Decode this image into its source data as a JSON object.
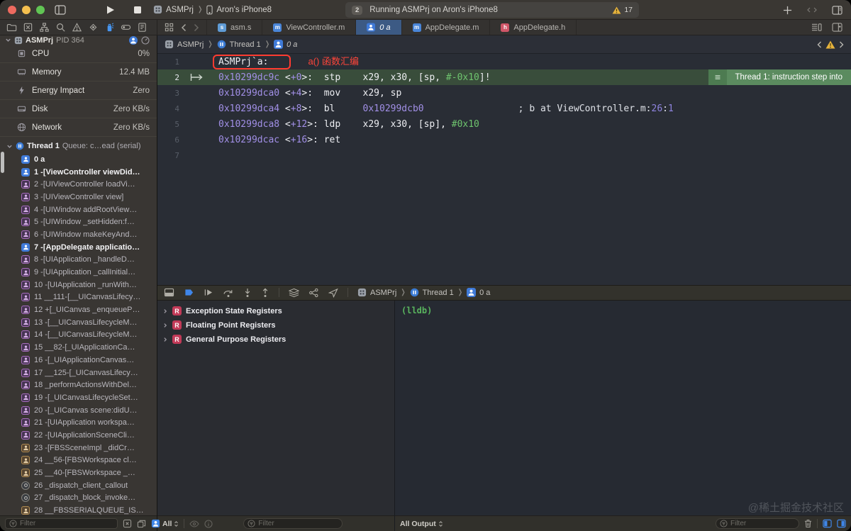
{
  "colors": {
    "accent_blue": "#3f86e8",
    "banner_green": "#5b8b5f",
    "highlight_green": "#394d3b",
    "annotation_red": "#ff3b30",
    "address_purple": "#a18fe6",
    "immediate_green": "#6ec46e",
    "warning_yellow": "#e6b33c",
    "register_badge": "#c23a58"
  },
  "titlebar": {
    "scheme": {
      "project": "ASMPrj",
      "device": "Aron's iPhone8"
    },
    "status": {
      "badge": "2",
      "text": "Running ASMPrj on Aron's iPhone8",
      "warning_count": "17"
    }
  },
  "tabbar": {
    "tabs": [
      {
        "label": "asm.s",
        "icon": "file-s-icon",
        "glyph": "s",
        "color": "#5f9bd5",
        "active": false
      },
      {
        "label": "ViewController.m",
        "icon": "file-m-icon",
        "glyph": "m",
        "color": "#4a86d8",
        "active": false
      },
      {
        "label": "0 a",
        "icon": "person-icon",
        "glyph": "person",
        "color": "#3f7ad8",
        "active": true
      },
      {
        "label": "AppDelegate.m",
        "icon": "file-m-icon",
        "glyph": "m",
        "color": "#4a86d8",
        "active": false
      },
      {
        "label": "AppDelegate.h",
        "icon": "file-h-icon",
        "glyph": "h",
        "color": "#d05668",
        "active": false
      }
    ]
  },
  "sidebar": {
    "process": {
      "name": "ASMPrj",
      "pid": "PID 364"
    },
    "gauges": [
      {
        "label": "CPU",
        "value": "0%",
        "icon": "cpu-icon"
      },
      {
        "label": "Memory",
        "value": "12.4 MB",
        "icon": "memory-icon"
      },
      {
        "label": "Energy Impact",
        "value": "Zero",
        "icon": "energy-icon"
      },
      {
        "label": "Disk",
        "value": "Zero KB/s",
        "icon": "disk-icon"
      },
      {
        "label": "Network",
        "value": "Zero KB/s",
        "icon": "network-icon"
      }
    ],
    "thread": {
      "label": "Thread 1",
      "queue": "Queue: c…ead (serial)"
    },
    "frames": [
      {
        "label": "0 a",
        "type": "user"
      },
      {
        "label": "1 -[ViewController viewDid…",
        "type": "user"
      },
      {
        "label": "2 -[UIViewController loadVi…",
        "type": "fw"
      },
      {
        "label": "3 -[UIViewController view]",
        "type": "fw"
      },
      {
        "label": "4 -[UIWindow addRootView…",
        "type": "fw"
      },
      {
        "label": "5 -[UIWindow _setHidden:f…",
        "type": "fw"
      },
      {
        "label": "6 -[UIWindow makeKeyAnd…",
        "type": "fw"
      },
      {
        "label": "7 -[AppDelegate applicatio…",
        "type": "user"
      },
      {
        "label": "8 -[UIApplication _handleD…",
        "type": "fw"
      },
      {
        "label": "9 -[UIApplication _callInitial…",
        "type": "fw"
      },
      {
        "label": "10 -[UIApplication _runWith…",
        "type": "fw"
      },
      {
        "label": "11 __111-[__UICanvasLifecy…",
        "type": "fw"
      },
      {
        "label": "12 +[_UICanvas _enqueueP…",
        "type": "fw"
      },
      {
        "label": "13 -[__UICanvasLifecycleM…",
        "type": "fw"
      },
      {
        "label": "14 -[__UICanvasLifecycleM…",
        "type": "fw"
      },
      {
        "label": "15 __82-[_UIApplicationCa…",
        "type": "fw"
      },
      {
        "label": "16 -[_UIApplicationCanvas…",
        "type": "fw"
      },
      {
        "label": "17 __125-[_UICanvasLifecy…",
        "type": "fw"
      },
      {
        "label": "18 _performActionsWithDel…",
        "type": "fw"
      },
      {
        "label": "19 -[_UICanvasLifecycleSet…",
        "type": "fw"
      },
      {
        "label": "20 -[_UICanvas scene:didU…",
        "type": "fw"
      },
      {
        "label": "21 -[UIApplication workspa…",
        "type": "fw"
      },
      {
        "label": "22 -[UIApplicationSceneCli…",
        "type": "fw"
      },
      {
        "label": "23 -[FBSSceneImpl _didCr…",
        "type": "lib"
      },
      {
        "label": "24 __56-[FBSWorkspace cl…",
        "type": "lib"
      },
      {
        "label": "25 __40-[FBSWorkspace _…",
        "type": "lib"
      },
      {
        "label": "26 _dispatch_client_callout",
        "type": "sys"
      },
      {
        "label": "27 _dispatch_block_invoke…",
        "type": "sys"
      },
      {
        "label": "28 __FBSSERIALQUEUE_IS…",
        "type": "lib"
      }
    ],
    "filter_placeholder": "Filter"
  },
  "editor": {
    "jumpbar": [
      {
        "icon": "app-icon",
        "label": "ASMPrj"
      },
      {
        "icon": "thread-icon",
        "label": "Thread 1"
      },
      {
        "icon": "person-icon",
        "label": "0 a",
        "italic": true
      }
    ],
    "lines": [
      {
        "num": "1",
        "boxed": "ASMPrj`a:",
        "annotation": "a() 函数汇编",
        "tokens": []
      },
      {
        "num": "2",
        "current": true,
        "banner": "Thread 1: instruction step into",
        "tokens": [
          [
            "0x10299dc9c",
            "a"
          ],
          [
            " <",
            "p"
          ],
          [
            "+0",
            "a"
          ],
          [
            ">:  ",
            "p"
          ],
          [
            "stp    ",
            "p"
          ],
          [
            "x29, x30, [sp, ",
            "p"
          ],
          [
            "#-0x10",
            "g"
          ],
          [
            "]!",
            "p"
          ]
        ]
      },
      {
        "num": "3",
        "tokens": [
          [
            "0x10299dca0",
            "a"
          ],
          [
            " <",
            "p"
          ],
          [
            "+4",
            "a"
          ],
          [
            ">:  ",
            "p"
          ],
          [
            "mov    ",
            "p"
          ],
          [
            "x29, sp",
            "p"
          ]
        ]
      },
      {
        "num": "4",
        "tokens": [
          [
            "0x10299dca4",
            "a"
          ],
          [
            " <",
            "p"
          ],
          [
            "+8",
            "a"
          ],
          [
            ">:  ",
            "p"
          ],
          [
            "bl     ",
            "p"
          ],
          [
            "0x10299dcb0",
            "a"
          ],
          [
            "                 ",
            "p"
          ],
          [
            "; b at ViewController.m:",
            "c"
          ],
          [
            "26",
            "n"
          ],
          [
            ":",
            "c"
          ],
          [
            "1",
            "n"
          ]
        ]
      },
      {
        "num": "5",
        "tokens": [
          [
            "0x10299dca8",
            "a"
          ],
          [
            " <",
            "p"
          ],
          [
            "+12",
            "a"
          ],
          [
            ">: ",
            "p"
          ],
          [
            "ldp    ",
            "p"
          ],
          [
            "x29, x30, [sp], ",
            "p"
          ],
          [
            "#0x10",
            "g"
          ]
        ]
      },
      {
        "num": "6",
        "tokens": [
          [
            "0x10299dcac",
            "a"
          ],
          [
            " <",
            "p"
          ],
          [
            "+16",
            "a"
          ],
          [
            ">: ",
            "p"
          ],
          [
            "ret",
            "p"
          ]
        ]
      },
      {
        "num": "7",
        "tokens": []
      }
    ]
  },
  "debug": {
    "breadcrumb": [
      {
        "icon": "app-icon",
        "label": "ASMPrj"
      },
      {
        "icon": "thread-icon",
        "label": "Thread 1"
      },
      {
        "icon": "person-icon",
        "label": "0 a"
      }
    ],
    "variables": [
      "Exception State Registers",
      "Floating Point Registers",
      "General Purpose Registers"
    ],
    "variables_bar": {
      "scope": "All",
      "filter_placeholder": "Filter"
    },
    "console": {
      "prompt": "(lldb)",
      "output_scope": "All Output",
      "filter_placeholder": "Filter",
      "watermark": "@稀土掘金技术社区"
    }
  }
}
